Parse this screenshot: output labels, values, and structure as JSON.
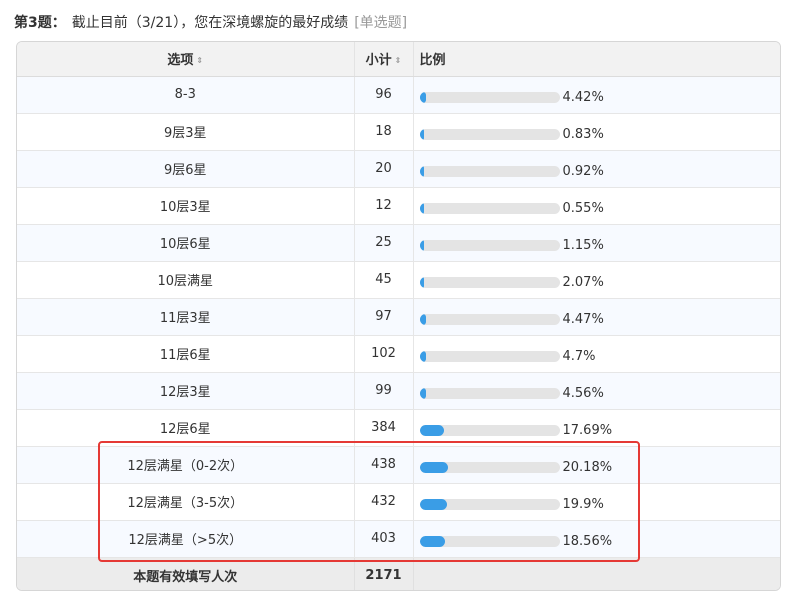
{
  "question": {
    "number": "第3题：",
    "text": "截止目前（3/21），您在深境螺旋的最好成绩",
    "type": "[单选题]"
  },
  "table": {
    "headers": {
      "option": "选项",
      "count": "小计",
      "ratio": "比例"
    },
    "sort_icon": "⇕",
    "rows": [
      {
        "option": "8-3",
        "count": "96",
        "percent": "4.42%",
        "ratio": 0.0442
      },
      {
        "option": "9层3星",
        "count": "18",
        "percent": "0.83%",
        "ratio": 0.0083
      },
      {
        "option": "9层6星",
        "count": "20",
        "percent": "0.92%",
        "ratio": 0.0092
      },
      {
        "option": "10层3星",
        "count": "12",
        "percent": "0.55%",
        "ratio": 0.0055
      },
      {
        "option": "10层6星",
        "count": "25",
        "percent": "1.15%",
        "ratio": 0.0115
      },
      {
        "option": "10层满星",
        "count": "45",
        "percent": "2.07%",
        "ratio": 0.0207
      },
      {
        "option": "11层3星",
        "count": "97",
        "percent": "4.47%",
        "ratio": 0.0447
      },
      {
        "option": "11层6星",
        "count": "102",
        "percent": "4.7%",
        "ratio": 0.047
      },
      {
        "option": "12层3星",
        "count": "99",
        "percent": "4.56%",
        "ratio": 0.0456
      },
      {
        "option": "12层6星",
        "count": "384",
        "percent": "17.69%",
        "ratio": 0.1769
      },
      {
        "option": "12层满星（0-2次）",
        "count": "438",
        "percent": "20.18%",
        "ratio": 0.2018
      },
      {
        "option": "12层满星（3-5次）",
        "count": "432",
        "percent": "19.9%",
        "ratio": 0.199
      },
      {
        "option": "12层满星（>5次）",
        "count": "403",
        "percent": "18.56%",
        "ratio": 0.1856
      }
    ],
    "footer": {
      "label": "本题有效填写人次",
      "total": "2171"
    }
  },
  "colors": {
    "bar": "#3a9de6",
    "bar_track": "#e4e4e4",
    "highlight": "#e53935"
  }
}
